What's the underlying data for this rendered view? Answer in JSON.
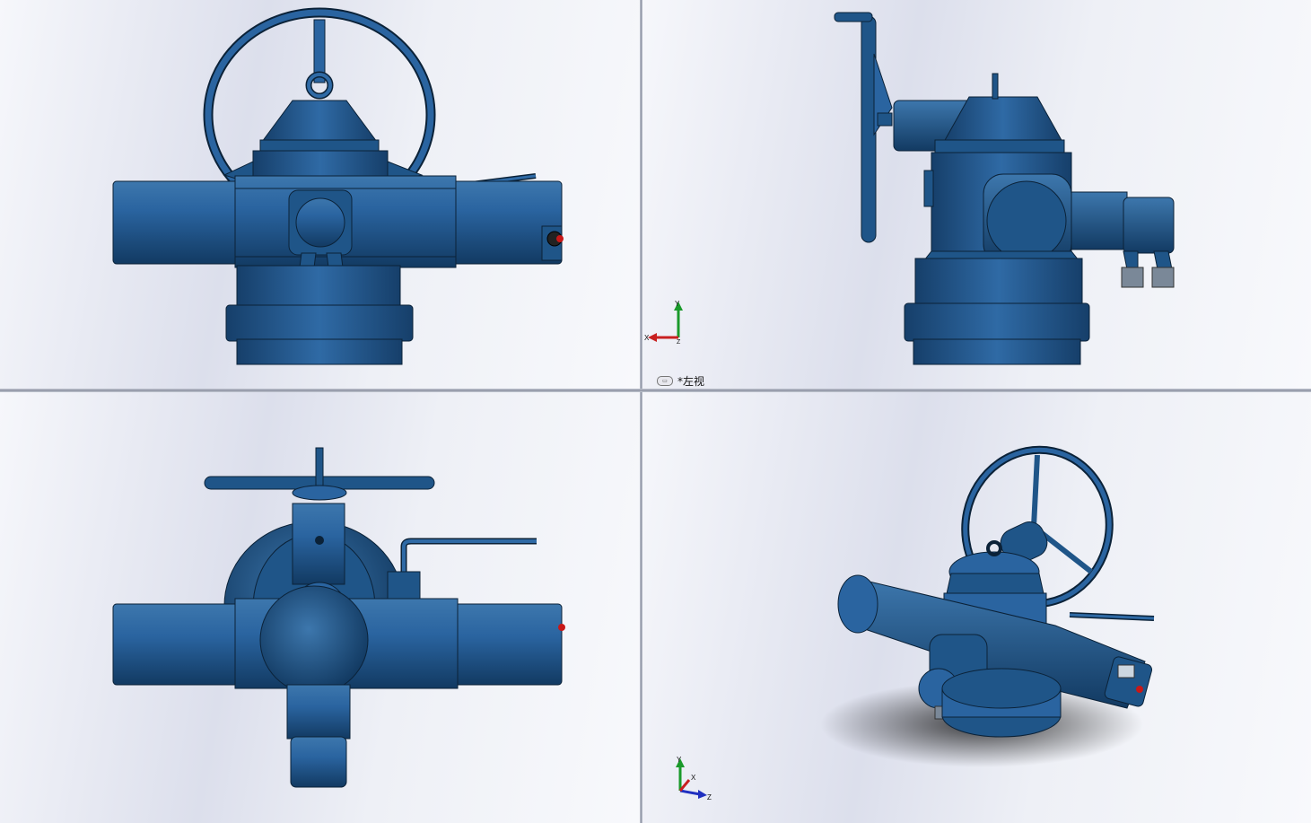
{
  "viewports": {
    "front": {
      "name": "front"
    },
    "left": {
      "name": "left",
      "label": "*左视",
      "triad": {
        "y": "Y",
        "x": "X",
        "z": "Z"
      }
    },
    "top": {
      "name": "top"
    },
    "iso": {
      "name": "isometric",
      "triad": {
        "y": "Y",
        "x": "X",
        "z": "Z"
      }
    }
  },
  "colors": {
    "body": "#1f5588",
    "body_dark": "#123a62",
    "body_light": "#4f86b8",
    "outline": "#0b2238",
    "background": "#e4e6f0",
    "accent_red": "#c81818",
    "axis_y": "#1a9a2a",
    "axis_x": "#c82020",
    "axis_z": "#2030c0"
  },
  "icons": [
    "view-orientation-icon",
    "axis-triad-icon"
  ]
}
